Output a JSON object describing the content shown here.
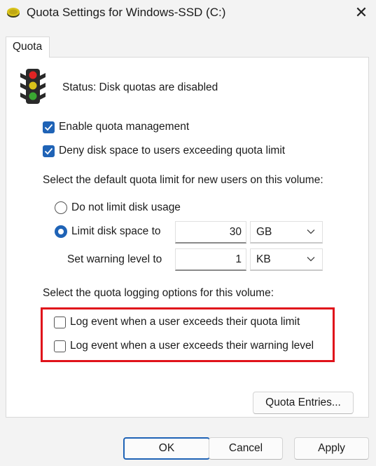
{
  "window": {
    "title": "Quota Settings for Windows-SSD (C:)"
  },
  "tabs": [
    {
      "label": "Quota"
    }
  ],
  "status": {
    "text": "Status:  Disk quotas are disabled"
  },
  "options": {
    "enable_quota_management": {
      "label": "Enable quota management",
      "checked": true
    },
    "deny_disk_space": {
      "label": "Deny disk space to users exceeding quota limit",
      "checked": true
    }
  },
  "default_quota": {
    "heading": "Select the default quota limit for new users on this volume:",
    "no_limit_label": "Do not limit disk usage",
    "limit_label": "Limit disk space to",
    "limit_value": "30",
    "limit_unit": "GB",
    "warning_label": "Set warning level to",
    "warning_value": "1",
    "warning_unit": "KB",
    "selected": "limit"
  },
  "logging": {
    "heading": "Select the quota logging options for this volume:",
    "exceeds_limit": {
      "label": "Log event when a user exceeds their quota limit",
      "checked": false
    },
    "exceeds_warning": {
      "label": "Log event when a user exceeds their warning level",
      "checked": false
    }
  },
  "buttons": {
    "quota_entries": "Quota Entries...",
    "ok": "OK",
    "cancel": "Cancel",
    "apply": "Apply"
  },
  "colors": {
    "accent": "#1f63b6",
    "highlight": "#e0131b"
  }
}
